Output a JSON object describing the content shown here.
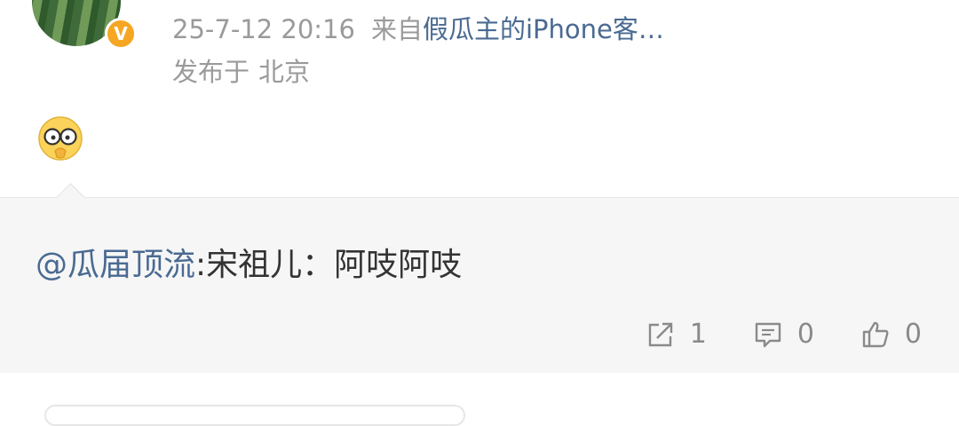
{
  "post": {
    "timestamp": "25-7-12 20:16",
    "source_prefix": "来自",
    "source_client": "假瓜主的iPhone客…",
    "location_prefix": "发布于",
    "location": "北京",
    "verified_badge": "V",
    "emoji_icon": "nerd-face-icon"
  },
  "retweet": {
    "mention": "@瓜届顶流",
    "text": ":宋祖儿：阿吱阿吱"
  },
  "actions": {
    "share_count": "1",
    "comment_count": "0",
    "like_count": "0"
  },
  "colors": {
    "link": "#4a6a92",
    "meta": "#9a9a9a",
    "badge": "#f5a623",
    "retweet_bg": "#f6f6f6"
  }
}
